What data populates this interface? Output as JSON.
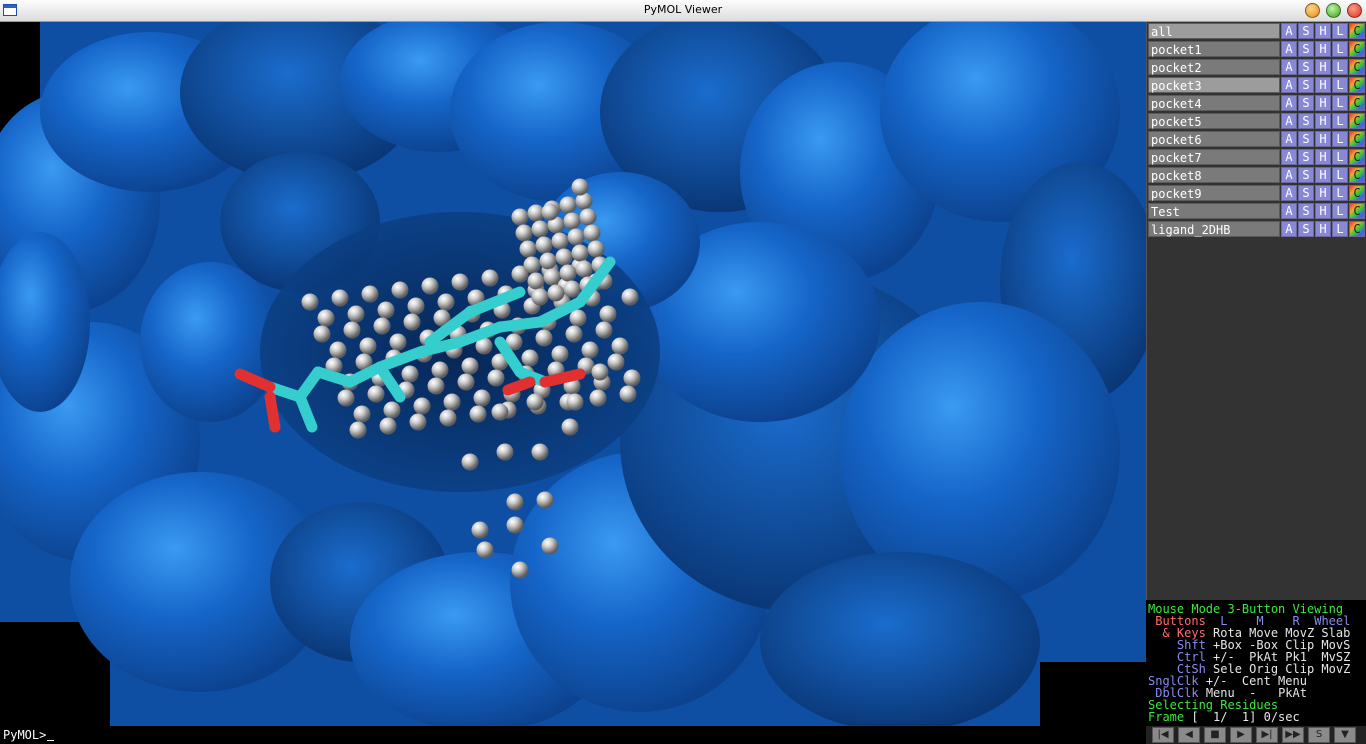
{
  "window": {
    "title": "PyMOL Viewer"
  },
  "objects": [
    {
      "name": "all",
      "selected": true
    },
    {
      "name": "pocket1",
      "selected": false
    },
    {
      "name": "pocket2",
      "selected": false
    },
    {
      "name": "pocket3",
      "selected": true
    },
    {
      "name": "pocket4",
      "selected": false
    },
    {
      "name": "pocket5",
      "selected": false
    },
    {
      "name": "pocket6",
      "selected": false
    },
    {
      "name": "pocket7",
      "selected": false
    },
    {
      "name": "pocket8",
      "selected": false
    },
    {
      "name": "pocket9",
      "selected": false
    },
    {
      "name": "Test",
      "selected": false
    },
    {
      "name": "ligand_2DHB",
      "selected": false
    }
  ],
  "object_buttons": [
    "A",
    "S",
    "H",
    "L",
    "C"
  ],
  "mouse_mode": {
    "line1_a": "Mouse Mode",
    "line1_b": "3-Button Viewing",
    "buttons_label": "Buttons",
    "col_l": "L",
    "col_m": "M",
    "col_r": "R",
    "col_wheel": "Wheel",
    "keys_label": "& Keys",
    "keys_vals": "Rota Move MovZ Slab",
    "shft_label": "Shft",
    "shft_vals": "+Box -Box Clip MovS",
    "ctrl_label": "Ctrl",
    "ctrl_vals": "+/-  PkAt Pk1  MvSZ",
    "ctsh_label": "CtSh",
    "ctsh_vals": "Sele Orig Clip MovZ",
    "snglclk_label": "SnglClk",
    "snglclk_vals": "+/-  Cent Menu",
    "dblclk_label": "DblClk",
    "dblclk_vals": "Menu  -   PkAt",
    "selecting_a": "Selecting",
    "selecting_b": "Residues",
    "frame_label": "Frame",
    "frame_vals": "[  1/  1] 0/sec"
  },
  "command_prompt": "PyMOL>",
  "frame_controls": [
    "|◀",
    "◀",
    "■",
    "▶",
    "▶|",
    "▶▶",
    "S",
    "▼"
  ],
  "colors": {
    "surface": "#1463c4",
    "ligand_carbon": "#35cdcd",
    "ligand_oxygen": "#e03030",
    "sphere": "#bdbdbd",
    "panel_bg": "#333333"
  }
}
